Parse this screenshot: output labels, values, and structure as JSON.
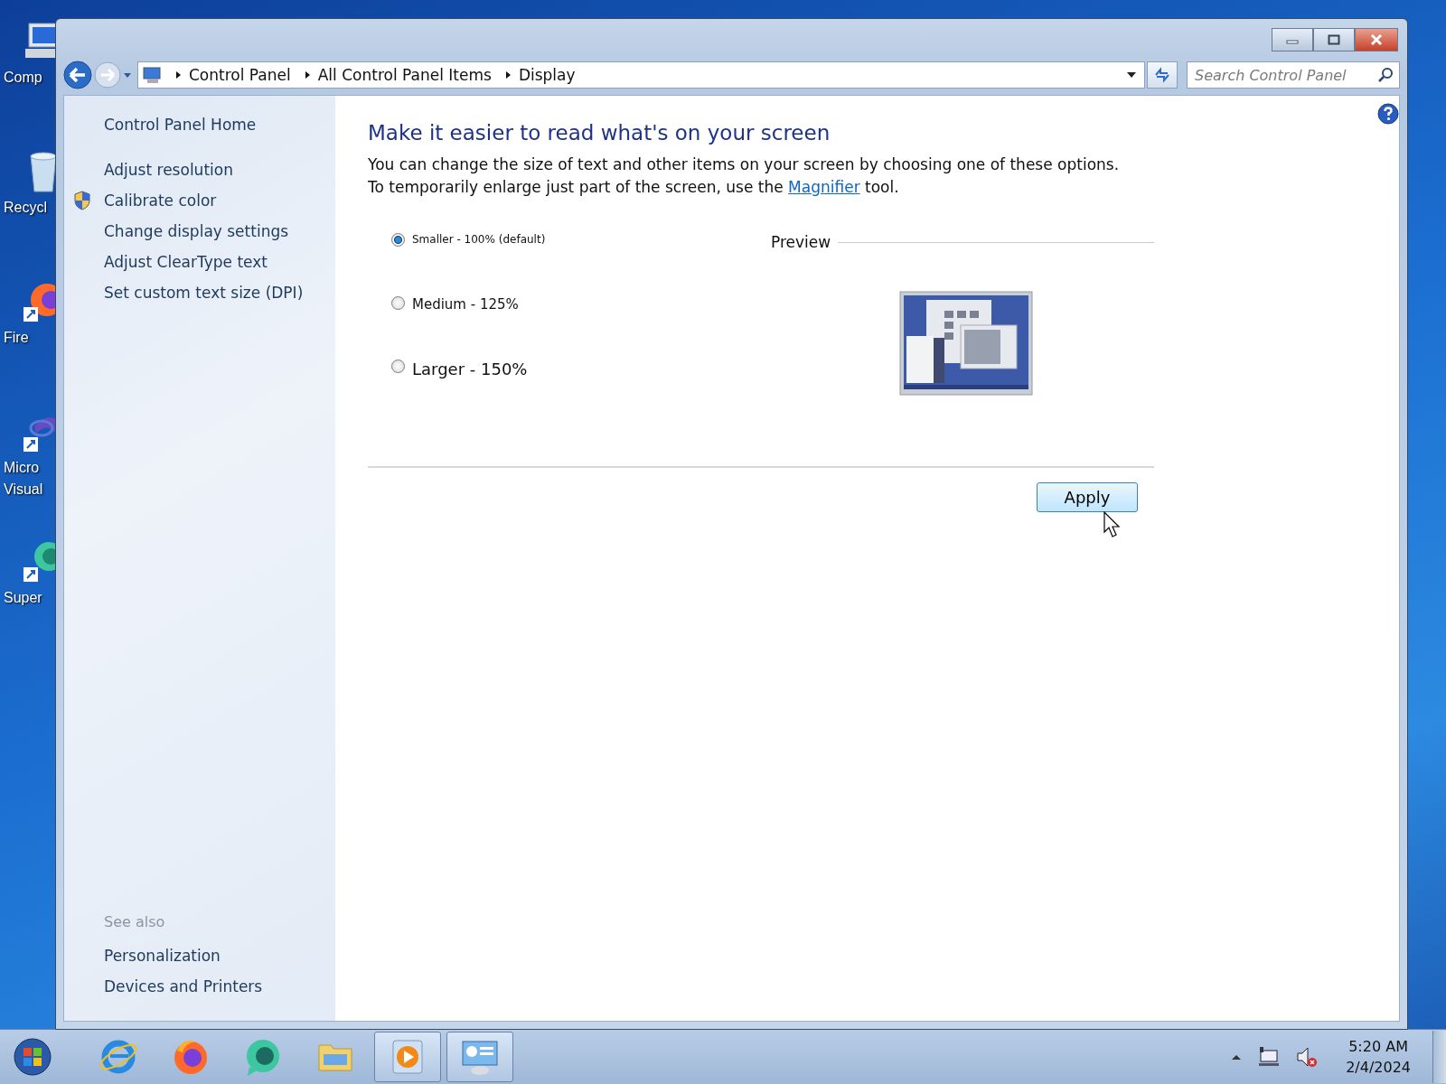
{
  "desktop_icons": [
    {
      "kind": "computer",
      "label": "Comp"
    },
    {
      "kind": "recycle",
      "label": "Recycl"
    },
    {
      "kind": "firefox",
      "label": "Fire"
    },
    {
      "kind": "vstudio",
      "label": "Micro Visual"
    },
    {
      "kind": "super",
      "label": "Super"
    }
  ],
  "address_bar": {
    "crumbs": [
      "Control Panel",
      "All Control Panel Items",
      "Display"
    ]
  },
  "search": {
    "placeholder": "Search Control Panel"
  },
  "sidebar": {
    "home": "Control Panel Home",
    "items": [
      {
        "label": "Adjust resolution",
        "shield": false
      },
      {
        "label": "Calibrate color",
        "shield": true
      },
      {
        "label": "Change display settings",
        "shield": false
      },
      {
        "label": "Adjust ClearType text",
        "shield": false
      },
      {
        "label": "Set custom text size (DPI)",
        "shield": false
      }
    ],
    "see_also": {
      "title": "See also",
      "items": [
        "Personalization",
        "Devices and Printers"
      ]
    }
  },
  "main": {
    "heading": "Make it easier to read what's on your screen",
    "description_before": "You can change the size of text and other items on your screen by choosing one of these options. To temporarily enlarge just part of the screen, use the",
    "link": "Magnifier",
    "description_after": "tool.",
    "options": [
      {
        "label": "Smaller - 100% (default)",
        "selected": true
      },
      {
        "label": "Medium - 125%",
        "selected": false
      },
      {
        "label": "Larger - 150%",
        "selected": false
      }
    ],
    "preview_label": "Preview",
    "apply_button": "Apply"
  },
  "taskbar": {
    "apps": [
      {
        "kind": "ie",
        "running": false
      },
      {
        "kind": "firefox",
        "running": false
      },
      {
        "kind": "chat",
        "running": false
      },
      {
        "kind": "folder",
        "running": false
      },
      {
        "kind": "media",
        "running": true
      },
      {
        "kind": "control",
        "running": true
      }
    ],
    "clock": {
      "time": "5:20 AM",
      "date": "2/4/2024"
    }
  }
}
